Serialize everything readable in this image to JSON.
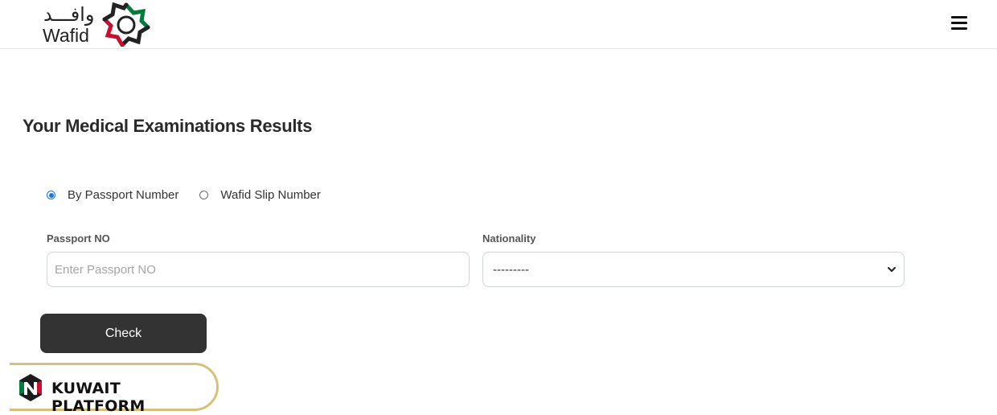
{
  "header": {
    "logo_arabic": "وافـــد",
    "logo_latin": "Wafid",
    "menu_icon": "hamburger-icon"
  },
  "page": {
    "title": "Your Medical Examinations Results"
  },
  "search_type": {
    "options": [
      {
        "label": "By Passport Number",
        "selected": true
      },
      {
        "label": "Wafid Slip Number",
        "selected": false
      }
    ]
  },
  "form": {
    "passport_label": "Passport NO",
    "passport_placeholder": "Enter Passport NO",
    "passport_value": "",
    "nationality_label": "Nationality",
    "nationality_selected": "---------",
    "submit_label": "Check"
  },
  "watermark": {
    "text": "KUWAIT PLATFORM"
  },
  "colors": {
    "accent": "#1a73e8",
    "button": "#333333",
    "watermark_border": "#d9c07a",
    "logo_red": "#c8102e",
    "logo_green": "#007a3d"
  }
}
